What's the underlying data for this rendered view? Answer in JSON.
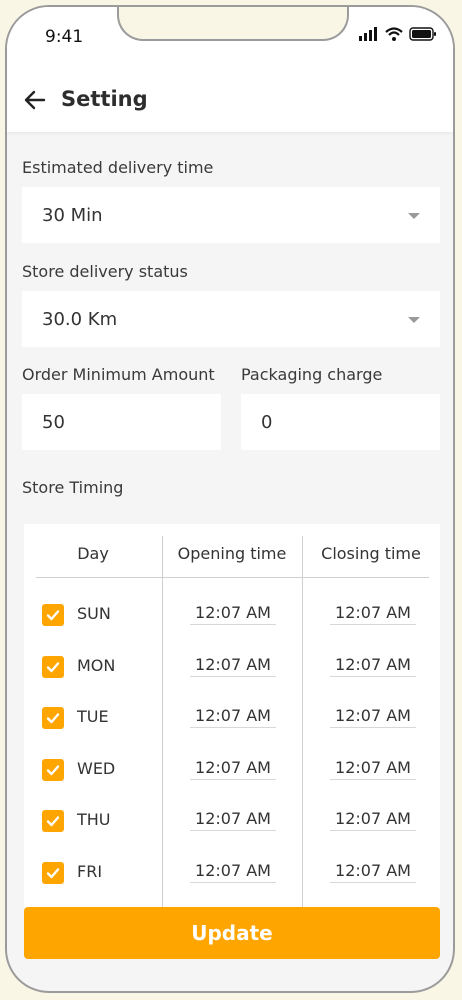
{
  "status_bar": {
    "time": "9:41"
  },
  "header": {
    "title": "Setting"
  },
  "delivery_time": {
    "label": "Estimated delivery time",
    "value": "30 Min"
  },
  "delivery_status": {
    "label": "Store delivery status",
    "value": "30.0 Km"
  },
  "min_amount": {
    "label": "Order Minimum Amount",
    "value": "50"
  },
  "packaging": {
    "label": "Packaging charge",
    "value": "0"
  },
  "timing": {
    "label": "Store Timing",
    "columns": [
      "Day",
      "Opening time",
      "Closing time"
    ],
    "rows": [
      {
        "day": "SUN",
        "checked": true,
        "open": "12:07 AM",
        "close": "12:07 AM"
      },
      {
        "day": "MON",
        "checked": true,
        "open": "12:07 AM",
        "close": "12:07 AM"
      },
      {
        "day": "TUE",
        "checked": true,
        "open": "12:07 AM",
        "close": "12:07 AM"
      },
      {
        "day": "WED",
        "checked": true,
        "open": "12:07 AM",
        "close": "12:07 AM"
      },
      {
        "day": "THU",
        "checked": true,
        "open": "12:07 AM",
        "close": "12:07 AM"
      },
      {
        "day": "FRI",
        "checked": true,
        "open": "12:07 AM",
        "close": "12:07 AM"
      }
    ]
  },
  "update_label": "Update",
  "colors": {
    "accent": "#FFA500",
    "background": "#F5F5F5"
  }
}
